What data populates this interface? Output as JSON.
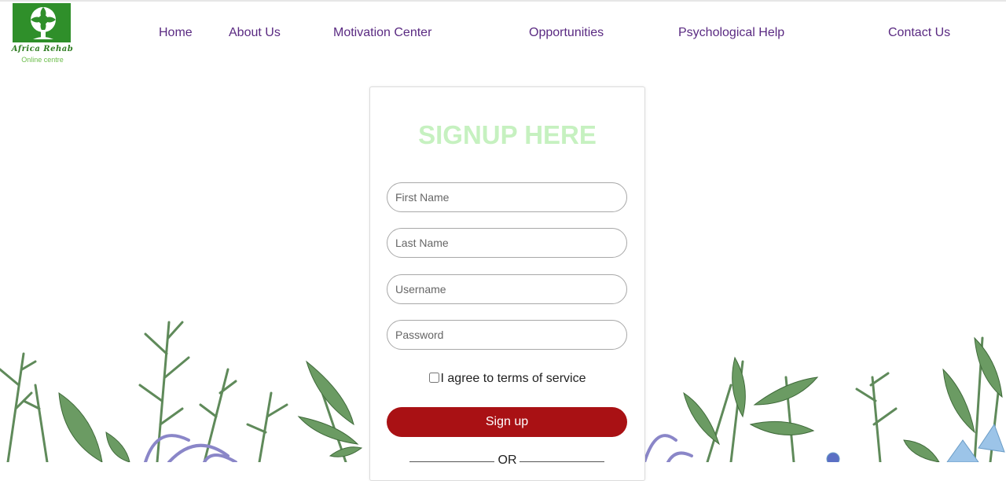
{
  "brand": {
    "title": "Africa Rehab",
    "subtitle": "Online centre",
    "icon": "tree-leaf-logo-icon",
    "colors": {
      "tile": "#2f8f2a",
      "title": "#2f7d22",
      "subtitle": "#6bbd4a"
    }
  },
  "nav": {
    "items": [
      {
        "label": "Home"
      },
      {
        "label": "About Us"
      },
      {
        "label": "Motivation Center"
      },
      {
        "label": "Opportunities"
      },
      {
        "label": "Psychological Help"
      },
      {
        "label": "Contact Us"
      }
    ],
    "color": "#5a2a82"
  },
  "form": {
    "title": "SIGNUP HERE",
    "first_name": {
      "placeholder": "First Name",
      "value": ""
    },
    "last_name": {
      "placeholder": "Last Name",
      "value": ""
    },
    "username": {
      "placeholder": "Username",
      "value": ""
    },
    "password": {
      "placeholder": "Password",
      "value": ""
    },
    "terms_label": "I agree to terms of service",
    "terms_checked": false,
    "submit_label": "Sign up",
    "separator": "OR"
  },
  "colors": {
    "title": "#c6f1c0",
    "button": "#a91114",
    "leaf": "#5f8a5a",
    "flower": "#8a86c8"
  }
}
